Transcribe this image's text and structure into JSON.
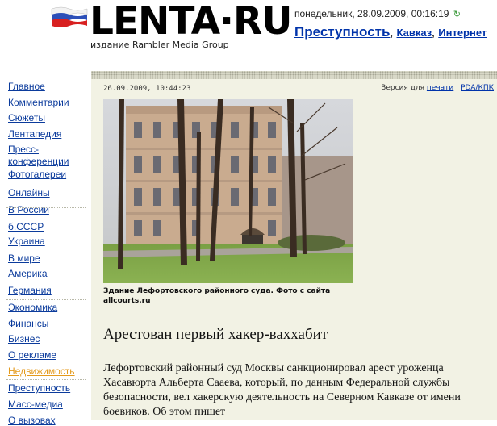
{
  "header": {
    "logo_text": "LENTA·RU",
    "subline": "издание Rambler Media Group",
    "date": "понедельник, 28.09.2009, 00:16:19",
    "refresh_icon": "refresh-icon",
    "nav": [
      {
        "label": "Преступность",
        "size": "big"
      },
      {
        "label": "Кавказ",
        "size": "mid"
      },
      {
        "label": "Интернет",
        "size": "mid"
      }
    ],
    "separator": ","
  },
  "sidebar": {
    "items": [
      {
        "label": "Главное"
      },
      {
        "label": "Комментарии"
      },
      {
        "label": "Сюжеты"
      },
      {
        "label": "Лентапедия"
      },
      {
        "label": "Пресс-конференции"
      },
      {
        "label": "Фотогалереи"
      },
      {
        "label": "Онлайны"
      },
      {
        "label": "В России"
      },
      {
        "label": "б.СССР"
      },
      {
        "label": "Украина"
      },
      {
        "label": "В мире"
      },
      {
        "label": "Америка"
      },
      {
        "label": "Германия"
      },
      {
        "label": "Экономика"
      },
      {
        "label": "Финансы"
      },
      {
        "label": "Бизнес"
      },
      {
        "label": "О рекламе"
      },
      {
        "label": "Недвижимость",
        "highlight": true
      },
      {
        "label": "Преступность"
      },
      {
        "label": "Масс-медиа"
      },
      {
        "label": "О вызовах"
      }
    ]
  },
  "article": {
    "timestamp": "26.09.2009, 10:44:23",
    "version_prefix": "Версия для",
    "print_link": "печати",
    "version_sep": "|",
    "pda_link": "PDA/КПК",
    "caption": "Здание Лефортовского районного суда. Фото с сайта allcourts.ru",
    "headline": "Арестован первый хакер-ваххабит",
    "paragraph": "Лефортовский районный суд Москвы санкционировал арест уроженца Хасавюрта Альберта Сааева, который, по данным Федеральной службы безопасности, вел хакерскую деятельность на Северном Кавказе от имени боевиков. Об этом пишет"
  },
  "colors": {
    "link": "#0b3b9c",
    "link_highlight": "#e49a1c",
    "content_bg": "#f2f2e4"
  }
}
